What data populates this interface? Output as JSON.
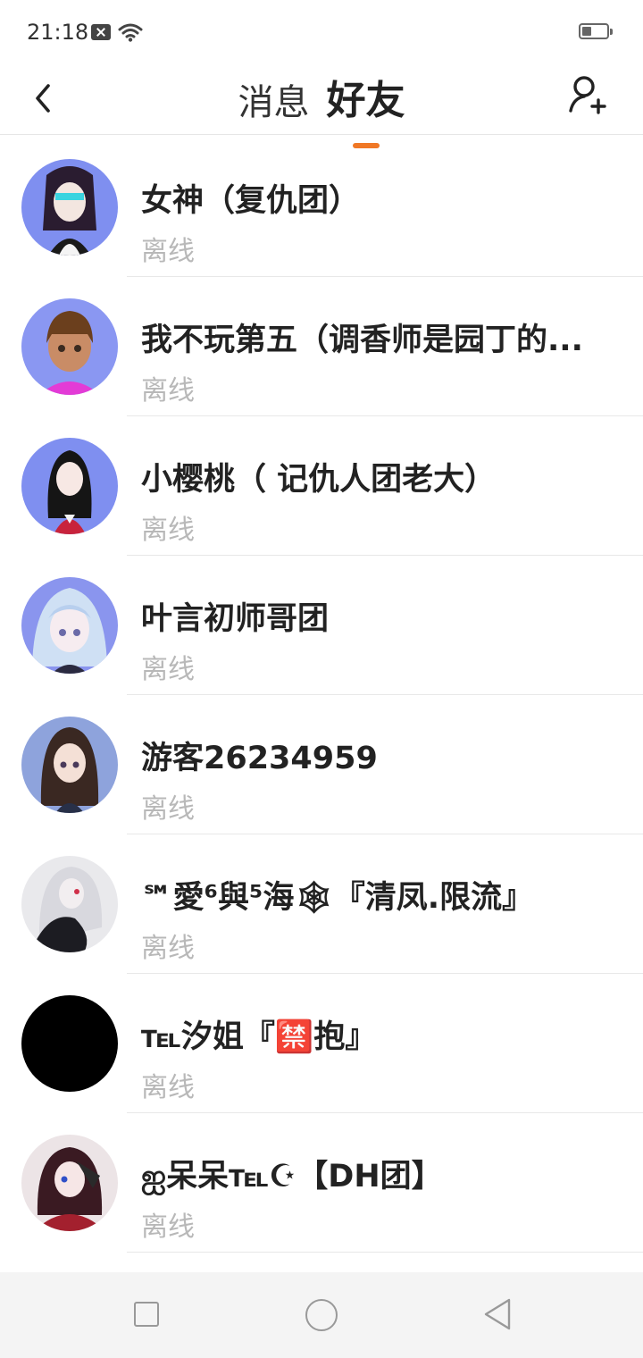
{
  "status_bar": {
    "time": "21:18"
  },
  "header": {
    "tabs": [
      {
        "label": "消息"
      },
      {
        "label": "好友"
      }
    ],
    "active_tab": "好友"
  },
  "friends": [
    {
      "name": "女神（复仇团）",
      "status": "离线"
    },
    {
      "name": "我不玩第五（调香师是园丁的...",
      "status": "离线"
    },
    {
      "name": "小樱桃（ 记仇人团老大）",
      "status": "离线"
    },
    {
      "name": "叶言初师哥团",
      "status": "离线"
    },
    {
      "name": "游客26234959",
      "status": "离线"
    },
    {
      "name": "℠愛⁶與⁵海🕸『清凤.限流』",
      "status": "离线"
    },
    {
      "name": "℡汐姐『🈲抱』",
      "status": "离线"
    },
    {
      "name": "ஐ呆呆℡☪【DH团】",
      "status": "离线"
    }
  ],
  "colors": {
    "accent": "#f07826",
    "offline_text": "#b8b8b8",
    "nav_background": "#f4f4f4"
  },
  "icons": [
    "back-arrow-icon",
    "add-friend-icon",
    "wifi-icon",
    "battery-icon",
    "recent-apps-icon",
    "home-icon",
    "nav-back-icon"
  ]
}
